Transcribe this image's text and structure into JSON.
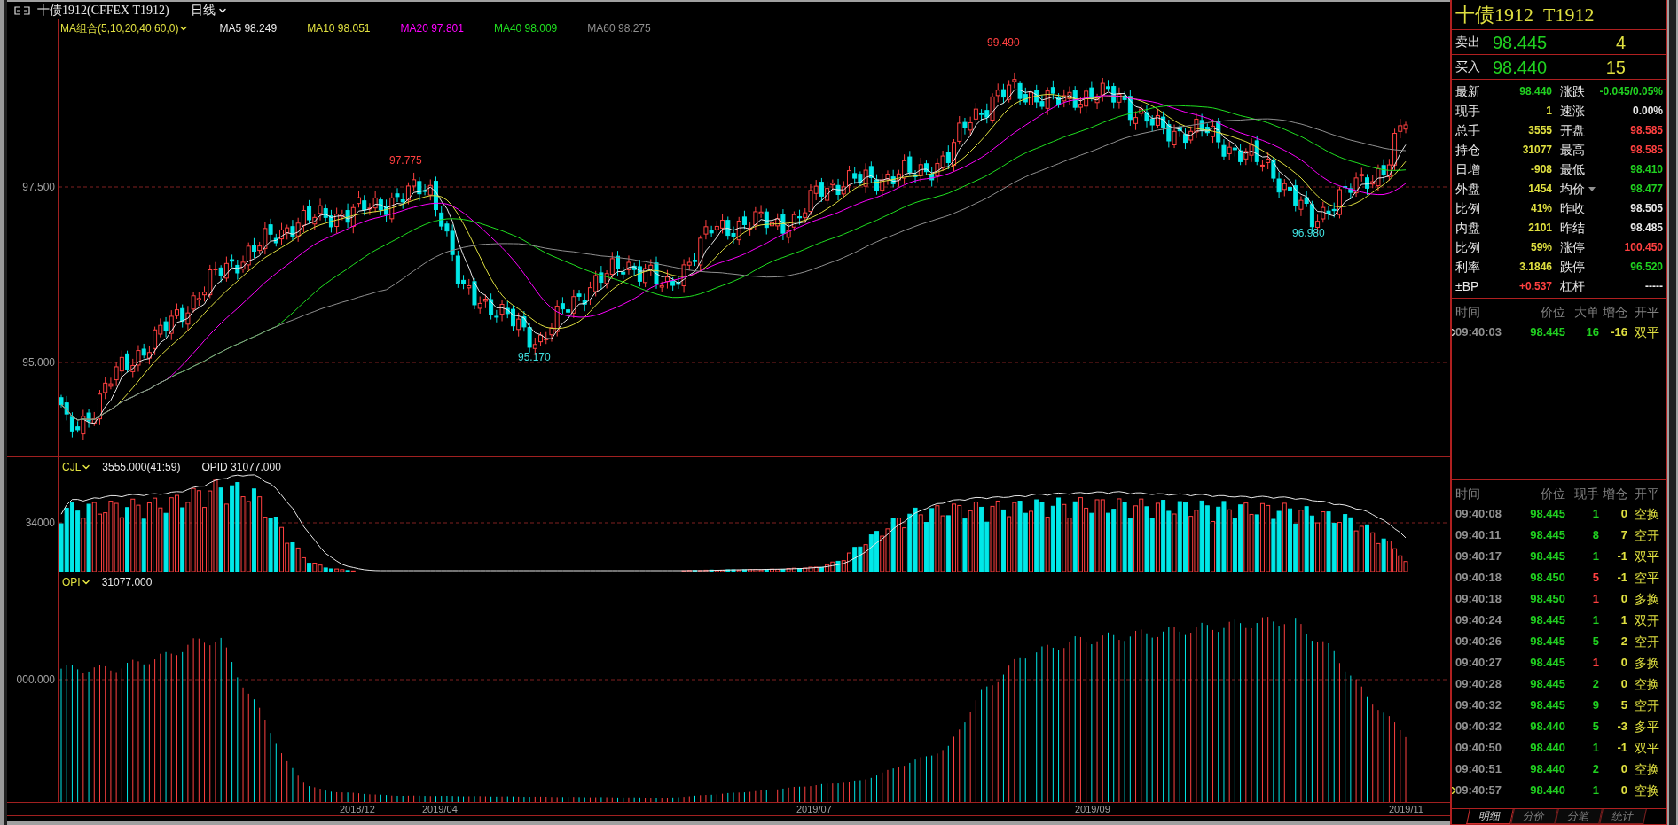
{
  "title_bar": {
    "title": "十债1912(CFFEX T1912)",
    "period": "日线"
  },
  "legend": {
    "indicator": "MA组合(5,10,20,40,60,0)",
    "items": [
      {
        "label": "MA5 98.249",
        "color": "#e8e8e8"
      },
      {
        "label": "MA10 98.051",
        "color": "#e0e040"
      },
      {
        "label": "MA20 97.801",
        "color": "#ff00ff"
      },
      {
        "label": "MA40 98.009",
        "color": "#20e020"
      },
      {
        "label": "MA60 98.275",
        "color": "#909090"
      }
    ]
  },
  "price_chart": {
    "y_labels": [
      "97.500",
      "95.000"
    ],
    "annotations": [
      {
        "text": "99.490",
        "color": "#ff4040"
      },
      {
        "text": "97.775",
        "color": "#ff4040"
      },
      {
        "text": "95.170",
        "color": "#40e0e0"
      },
      {
        "text": "96.980",
        "color": "#40e0e0"
      }
    ]
  },
  "volume_panel": {
    "name": "CJL",
    "values": [
      "3555.000(41:59)",
      "OPID 31077.000"
    ],
    "y_label": "34000"
  },
  "open_interest_panel": {
    "name": "OPI",
    "value": "31077.000",
    "y_label": "000.000"
  },
  "x_axis": {
    "labels": [
      "2018/12",
      "2019/04",
      "2019/07",
      "2019/09",
      "2019/11"
    ]
  },
  "quote": {
    "title": "十债1912  T1912",
    "ask": {
      "label": "卖出",
      "price": "98.445",
      "volume": "4"
    },
    "bid": {
      "label": "买入",
      "price": "98.440",
      "volume": "15"
    },
    "stats": [
      {
        "left": {
          "label": "最新",
          "value": "98.440",
          "color": "#20d020"
        },
        "right": {
          "label": "涨跌",
          "value": "-0.045/0.05%",
          "color": "#20d020",
          "dropdown": false
        }
      },
      {
        "left": {
          "label": "现手",
          "value": "1",
          "color": "#e0e040"
        },
        "right": {
          "label": "速涨",
          "value": "0.00%",
          "color": "#e8e8e8",
          "dropdown": false
        }
      },
      {
        "left": {
          "label": "总手",
          "value": "3555",
          "color": "#e0e040"
        },
        "right": {
          "label": "开盘",
          "value": "98.585",
          "color": "#ff4040",
          "dropdown": false
        }
      },
      {
        "left": {
          "label": "持仓",
          "value": "31077",
          "color": "#e0e040"
        },
        "right": {
          "label": "最高",
          "value": "98.585",
          "color": "#ff4040",
          "dropdown": false
        }
      },
      {
        "left": {
          "label": "日增",
          "value": "-908",
          "color": "#e0e040"
        },
        "right": {
          "label": "最低",
          "value": "98.410",
          "color": "#20d020",
          "dropdown": false
        }
      },
      {
        "left": {
          "label": "外盘",
          "value": "1454",
          "color": "#e0e040"
        },
        "right": {
          "label": "均价",
          "value": "98.477",
          "color": "#20d020",
          "dropdown": true
        }
      },
      {
        "left": {
          "label": "比例",
          "value": "41%",
          "color": "#e0e040"
        },
        "right": {
          "label": "昨收",
          "value": "98.505",
          "color": "#e8e8e8",
          "dropdown": false
        }
      },
      {
        "left": {
          "label": "内盘",
          "value": "2101",
          "color": "#e0e040"
        },
        "right": {
          "label": "昨结",
          "value": "98.485",
          "color": "#e8e8e8",
          "dropdown": false
        }
      },
      {
        "left": {
          "label": "比例",
          "value": "59%",
          "color": "#e0e040"
        },
        "right": {
          "label": "涨停",
          "value": "100.450",
          "color": "#ff4040",
          "dropdown": false
        }
      },
      {
        "left": {
          "label": "利率",
          "value": "3.1846",
          "color": "#e0e040"
        },
        "right": {
          "label": "跌停",
          "value": "96.520",
          "color": "#20d020",
          "dropdown": false
        }
      },
      {
        "left": {
          "label": "±BP",
          "value": "+0.537",
          "color": "#ff4040"
        },
        "right": {
          "label": "杠杆",
          "value": "-----",
          "color": "#e8e8e8",
          "dropdown": false
        }
      }
    ]
  },
  "big_orders": {
    "columns": [
      "时间",
      "价位",
      "大单",
      "增仓",
      "开平"
    ],
    "rows": [
      {
        "time": "09:40:03",
        "price": "98.445",
        "size": "16",
        "change": "-16",
        "type": "双平",
        "selected": true
      }
    ]
  },
  "trades": {
    "columns": [
      "时间",
      "价位",
      "现手",
      "增仓",
      "开平"
    ],
    "rows": [
      {
        "time": "09:40:08",
        "price": "98.445",
        "volume": "1",
        "color": "#20d020",
        "change": "0",
        "type": "空换",
        "selected": false
      },
      {
        "time": "09:40:11",
        "price": "98.445",
        "volume": "8",
        "color": "#20d020",
        "change": "7",
        "type": "空开",
        "selected": false
      },
      {
        "time": "09:40:17",
        "price": "98.445",
        "volume": "1",
        "color": "#20d020",
        "change": "-1",
        "type": "双平",
        "selected": false
      },
      {
        "time": "09:40:18",
        "price": "98.450",
        "volume": "5",
        "color": "#ff4040",
        "change": "-1",
        "type": "空平",
        "selected": false
      },
      {
        "time": "09:40:18",
        "price": "98.450",
        "volume": "1",
        "color": "#ff4040",
        "change": "0",
        "type": "多换",
        "selected": false
      },
      {
        "time": "09:40:24",
        "price": "98.445",
        "volume": "1",
        "color": "#20d020",
        "change": "1",
        "type": "双开",
        "selected": false
      },
      {
        "time": "09:40:26",
        "price": "98.445",
        "volume": "5",
        "color": "#20d020",
        "change": "2",
        "type": "空开",
        "selected": false
      },
      {
        "time": "09:40:27",
        "price": "98.445",
        "volume": "1",
        "color": "#ff4040",
        "change": "0",
        "type": "多换",
        "selected": false
      },
      {
        "time": "09:40:28",
        "price": "98.445",
        "volume": "2",
        "color": "#20d020",
        "change": "0",
        "type": "空换",
        "selected": false
      },
      {
        "time": "09:40:32",
        "price": "98.445",
        "volume": "9",
        "color": "#20d020",
        "change": "5",
        "type": "空开",
        "selected": false
      },
      {
        "time": "09:40:32",
        "price": "98.440",
        "volume": "5",
        "color": "#20d020",
        "change": "-3",
        "type": "多平",
        "selected": false
      },
      {
        "time": "09:40:50",
        "price": "98.440",
        "volume": "1",
        "color": "#20d020",
        "change": "-1",
        "type": "双平",
        "selected": false
      },
      {
        "time": "09:40:51",
        "price": "98.440",
        "volume": "2",
        "color": "#20d020",
        "change": "0",
        "type": "空换",
        "selected": false
      },
      {
        "time": "09:40:57",
        "price": "98.440",
        "volume": "1",
        "color": "#20d020",
        "change": "0",
        "type": "空换",
        "selected": true
      }
    ]
  },
  "tabs": [
    {
      "label": "明细",
      "selected": true
    },
    {
      "label": "分价",
      "selected": false
    },
    {
      "label": "分笔",
      "selected": false
    },
    {
      "label": "统计",
      "selected": false
    }
  ]
}
